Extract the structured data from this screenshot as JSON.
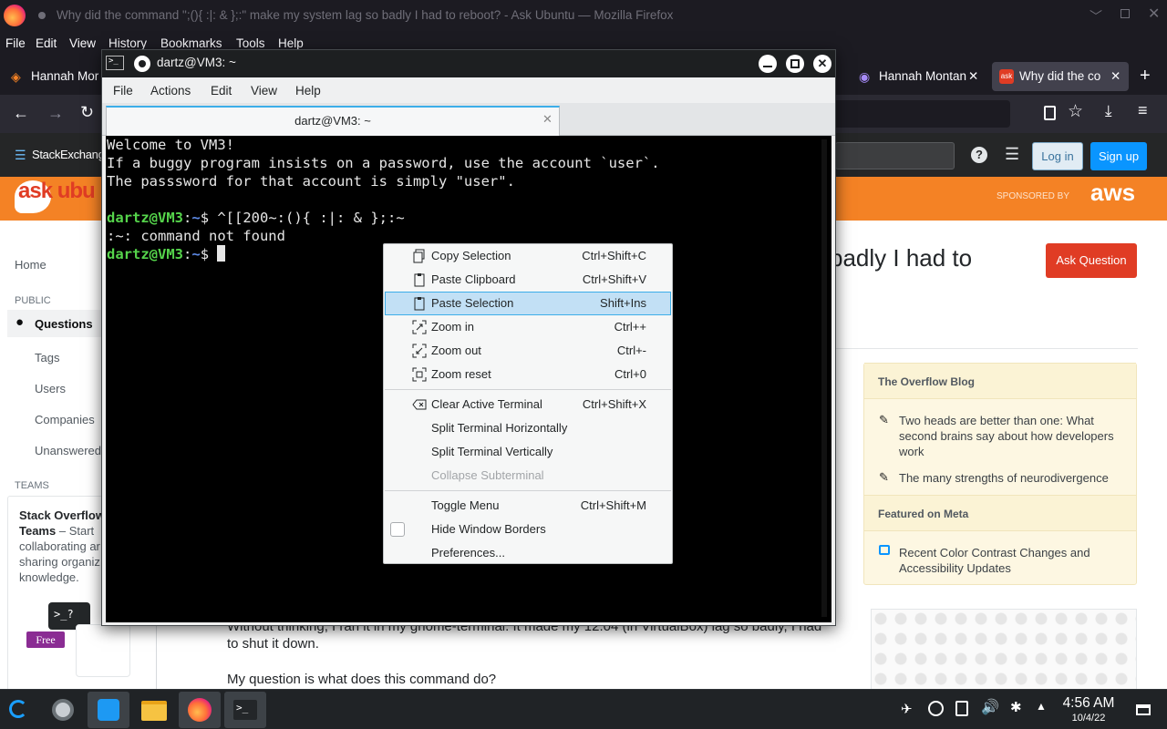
{
  "firefox": {
    "window_title": "Why did the command \";(){ :|: & };:\" make my system lag so badly I had to reboot? - Ask Ubuntu — Mozilla Firefox",
    "menu": [
      "File",
      "Edit",
      "View",
      "History",
      "Bookmarks",
      "Tools",
      "Help"
    ],
    "tabs": [
      {
        "label": "Hannah Mor"
      },
      {
        "label": "Hannah Montan"
      },
      {
        "label": "Why did the co"
      }
    ]
  },
  "site": {
    "brand": "StackExchange",
    "login": "Log in",
    "signup": "Sign up",
    "ask_logo": "ask ubu",
    "sponsored": "SPONSORED BY",
    "sponsor": "aws",
    "question_title_fragment": "badly I had to",
    "ask_question": "Ask Question",
    "nav": {
      "home": "Home",
      "public": "PUBLIC",
      "questions": "Questions",
      "tags": "Tags",
      "users": "Users",
      "companies": "Companies",
      "unanswered": "Unanswered",
      "teams": "TEAMS",
      "teams_title": "Stack Overflow",
      "teams_word": "Teams",
      "teams_rest": " – Start",
      "teams_l2": "collaborating ar",
      "teams_l3": "sharing organiz",
      "teams_l4": "knowledge.",
      "teams_term": ">_?",
      "free": "Free"
    },
    "blog": {
      "heading": "The Overflow Blog",
      "items": [
        "Two heads are better than one: What second brains say about how developers work",
        "The many strengths of neurodivergence"
      ],
      "meta_heading": "Featured on Meta",
      "meta_items": [
        "Recent Color Contrast Changes and Accessibility Updates"
      ]
    },
    "body_partial": "Without thinking, I ran it in my gnome-terminal. It made my 12.04 (in VirtualBox) lag so badly, I had",
    "body_line2": "to shut it down.",
    "body_line3": "My question is what does this command do?"
  },
  "terminal": {
    "title": "dartz@VM3: ~",
    "tab_title": "dartz@VM3: ~",
    "menu": [
      "File",
      "Actions",
      "Edit",
      "View",
      "Help"
    ],
    "lines": {
      "l1": "Welcome to VM3!",
      "l2": "If a buggy program insists on a password, use the account `user`.",
      "l3": "The passsword for that account is simply \"user\".",
      "p1_user": "dartz@VM3",
      "p1_sep": ":",
      "p1_path": "~",
      "p1_cmd": "$ ^[[200~:(){ :|: & };:~",
      "l5": ":~: command not found",
      "p2_user": "dartz@VM3",
      "p2_sep": ":",
      "p2_path": "~",
      "p2_cmd": "$ "
    }
  },
  "context_menu": {
    "items": [
      {
        "label": "Copy Selection",
        "shortcut": "Ctrl+Shift+C",
        "icon": "copy-icon"
      },
      {
        "label": "Paste Clipboard",
        "shortcut": "Ctrl+Shift+V",
        "icon": "paste-icon"
      },
      {
        "label": "Paste Selection",
        "shortcut": "Shift+Ins",
        "icon": "paste-icon"
      },
      {
        "label": "Zoom in",
        "shortcut": "Ctrl++",
        "icon": "zoom-in-icon"
      },
      {
        "label": "Zoom out",
        "shortcut": "Ctrl+-",
        "icon": "zoom-out-icon"
      },
      {
        "label": "Zoom reset",
        "shortcut": "Ctrl+0",
        "icon": "zoom-reset-icon"
      },
      {
        "label": "Clear Active Terminal",
        "shortcut": "Ctrl+Shift+X",
        "icon": "clear-icon"
      },
      {
        "label": "Split Terminal Horizontally",
        "shortcut": ""
      },
      {
        "label": "Split Terminal Vertically",
        "shortcut": ""
      },
      {
        "label": "Collapse Subterminal",
        "shortcut": ""
      },
      {
        "label": "Toggle Menu",
        "shortcut": "Ctrl+Shift+M"
      },
      {
        "label": "Hide Window Borders",
        "shortcut": ""
      },
      {
        "label": "Preferences...",
        "shortcut": ""
      }
    ]
  },
  "taskbar": {
    "time": "4:56 AM",
    "date": "10/4/22"
  },
  "colors": {
    "terminal_prompt_green": "#55d44b",
    "terminal_path_blue": "#5e8be8",
    "menu_highlight": "#c2e0f5",
    "accent": "#3daee9",
    "askubuntu_orange": "#f48225",
    "ask_button_red": "#e03c24"
  }
}
